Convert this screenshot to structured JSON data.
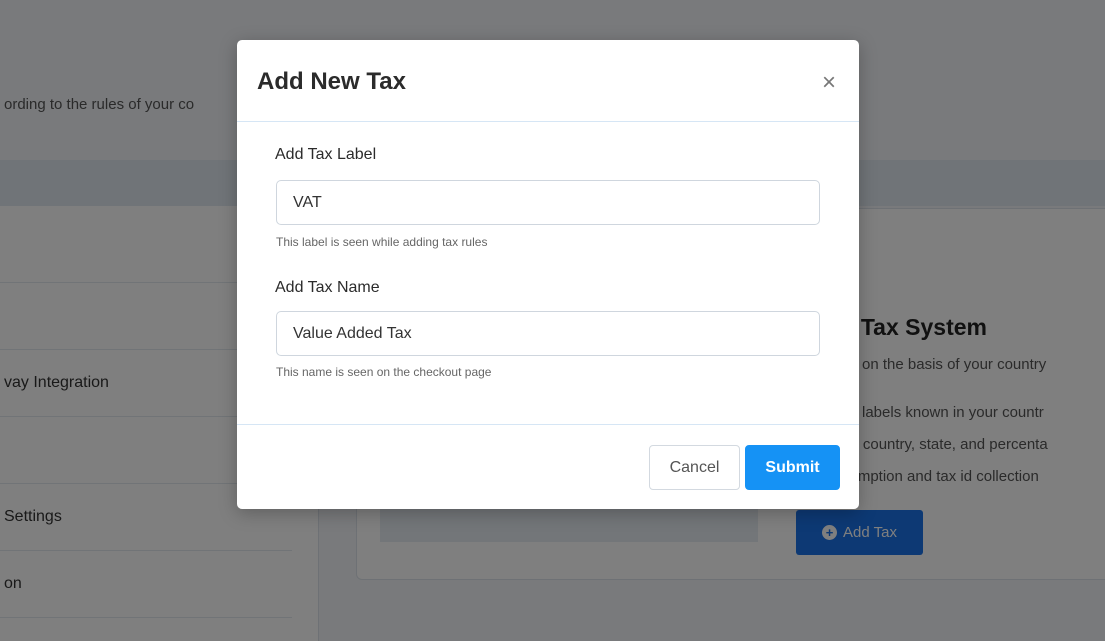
{
  "background": {
    "subtitle": "ording to the rules of your co",
    "sidebar_items": [
      {
        "label": ""
      },
      {
        "label": ""
      },
      {
        "label": "vay Integration"
      },
      {
        "label": ""
      },
      {
        "label": " Settings"
      },
      {
        "label": "on"
      }
    ],
    "content": {
      "heading": "te Tax System",
      "lines": [
        "ax on the basis of your country",
        "ax labels known in your countr",
        "on country, state, and percenta",
        "xemption and tax id collection"
      ],
      "add_tax_label": "Add Tax",
      "add_tax_icon": "plus-circle-icon"
    }
  },
  "modal": {
    "title": "Add New Tax",
    "close_icon": "×",
    "fields": [
      {
        "label": "Add Tax Label",
        "value": "VAT",
        "hint": "This label is seen while adding tax rules"
      },
      {
        "label": "Add Tax Name",
        "value": "Value Added Tax",
        "hint": "This name is seen on the checkout page"
      }
    ],
    "cancel_label": "Cancel",
    "submit_label": "Submit"
  },
  "colors": {
    "primary": "#1592f5",
    "bg_button": "#1a73e8",
    "overlay": "rgba(0,0,0,0.5)"
  }
}
